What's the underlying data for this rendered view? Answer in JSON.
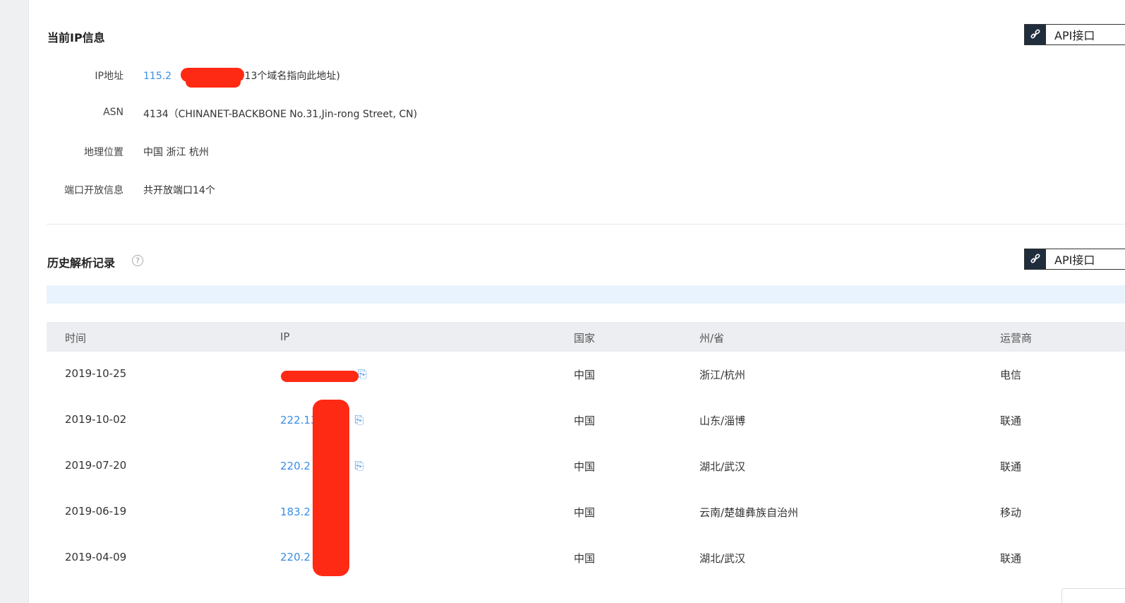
{
  "ip_info": {
    "title": "当前IP信息",
    "api_label": "API接口",
    "rows": [
      {
        "label": "IP地址",
        "value_prefix": "115.2",
        "value_suffix": "(共有13个域名指向此地址)"
      },
      {
        "label": "ASN",
        "value": "4134（CHINANET-BACKBONE No.31,Jin-rong Street, CN)"
      },
      {
        "label": "地理位置",
        "value": "中国 浙江 杭州"
      },
      {
        "label": "端口开放信息",
        "value": "共开放端口14个"
      }
    ]
  },
  "history": {
    "title": "历史解析记录",
    "help_icon": "?",
    "api_label": "API接口",
    "columns": {
      "time": "时间",
      "ip": "IP",
      "country": "国家",
      "region": "州/省",
      "isp": "运营商"
    },
    "rows": [
      {
        "time": "2019-10-25",
        "ip": "",
        "country": "中国",
        "region": "浙江/杭州",
        "isp": "电信"
      },
      {
        "time": "2019-10-02",
        "ip": "222.13    .84",
        "country": "中国",
        "region": "山东/淄博",
        "isp": "联通"
      },
      {
        "time": "2019-07-20",
        "ip": "220.2    .153",
        "country": "中国",
        "region": "湖北/武汉",
        "isp": "联通"
      },
      {
        "time": "2019-06-19",
        "ip": "183.2    2",
        "country": "中国",
        "region": "云南/楚雄彝族自治州",
        "isp": "移动"
      },
      {
        "time": "2019-04-09",
        "ip": "220.2    .153",
        "country": "中国",
        "region": "湖北/武汉",
        "isp": "联通"
      }
    ]
  },
  "colors": {
    "link": "#3a8ee6",
    "redaction": "#ff2a14",
    "notice_bg": "#e9f3fd",
    "header_bg": "#eceef1"
  },
  "icons": {
    "api": "link-icon",
    "copy": "copy-icon",
    "help": "question-circle-icon"
  }
}
